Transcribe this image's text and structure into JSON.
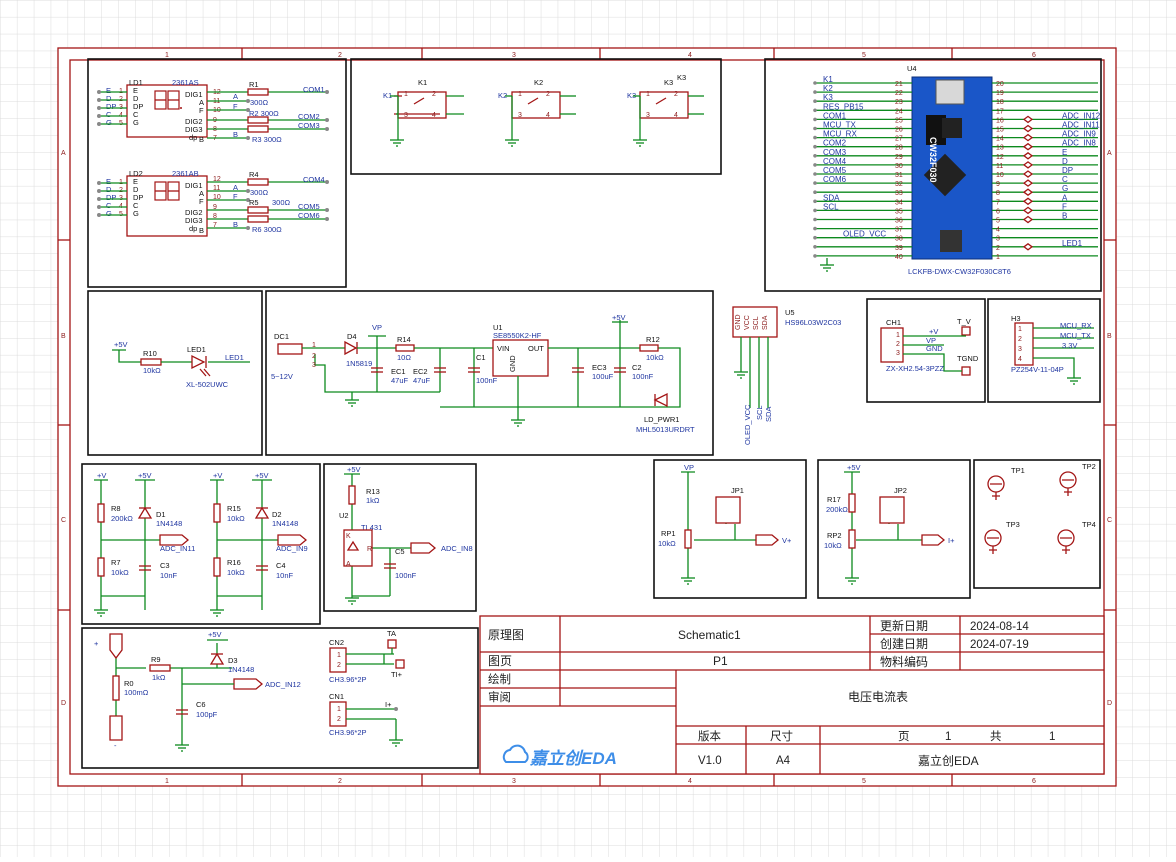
{
  "title_block": {
    "schematic_label": "原理图",
    "schematic_name": "Schematic1",
    "page_label": "图页",
    "page_value": "P1",
    "drawn_label": "绘制",
    "review_label": "审阅",
    "update_date_label": "更新日期",
    "update_date": "2024-08-14",
    "create_date_label": "创建日期",
    "create_date": "2024-07-19",
    "part_no_label": "物料编码",
    "project_name": "电压电流表",
    "version_label": "版本",
    "version": "V1.0",
    "size_label": "尺寸",
    "size": "A4",
    "page_no_label": "页",
    "page_no": "1",
    "total_label": "共",
    "total": "1",
    "company": "嘉立创EDA",
    "logo_text": "嘉立创EDA"
  },
  "frame": {
    "cols": [
      "1",
      "2",
      "3",
      "4",
      "5",
      "6"
    ],
    "rows": [
      "A",
      "B",
      "C",
      "D"
    ]
  },
  "display": {
    "d1": {
      "ref": "LD1",
      "part": "2361AS",
      "left_pins": [
        "E",
        "D",
        "DP",
        "C",
        "G"
      ],
      "left_nums": [
        "1",
        "2",
        "3",
        "4",
        "5"
      ],
      "inner_left": [
        "E",
        "D",
        "DP",
        "C",
        "G"
      ],
      "inner_right": [
        "DIG1",
        "A",
        "F",
        "DIG2",
        "DIG3",
        "B"
      ],
      "inner_right2": [
        "dp"
      ],
      "right_nums": [
        "12",
        "11",
        "10",
        "9",
        "8",
        "7"
      ]
    },
    "d2": {
      "ref": "LD2",
      "part": "2361AB",
      "left_pins": [
        "E",
        "D",
        "DP",
        "C",
        "G"
      ],
      "left_nums": [
        "1",
        "2",
        "3",
        "4",
        "5"
      ],
      "inner_left": [
        "E",
        "D",
        "DP",
        "C",
        "G"
      ],
      "inner_right": [
        "DIG1",
        "A",
        "F",
        "DIG2",
        "DIG3",
        "B"
      ],
      "inner_right2": [
        "dp"
      ],
      "right_nums": [
        "12",
        "11",
        "10",
        "9",
        "8",
        "7"
      ]
    },
    "r1": "R1",
    "r1v": "300Ω",
    "r2": "R2 300Ω",
    "r3": "R3 300Ω",
    "com1": "COM1",
    "com2": "COM2",
    "com3": "COM3",
    "A1": "A",
    "F1": "F",
    "B1": "B",
    "r4": "R4",
    "r4v": "300Ω",
    "r5": "R5",
    "r5v": "300Ω",
    "r6": "R6 300Ω",
    "com4": "COM4",
    "com5": "COM5",
    "com6": "COM6"
  },
  "keys": [
    {
      "ref": "K1",
      "net": "K1",
      "sub": "K1"
    },
    {
      "ref": "K2",
      "net": "K2",
      "sub": "K2"
    },
    {
      "ref": "K3",
      "net": "K3",
      "sub": "K3"
    }
  ],
  "mcu": {
    "ref": "U4",
    "part": "LCKFB-DWX-CW32F030C8T6",
    "left_nets": [
      "K1",
      "K2",
      "K3",
      "RES_PB15",
      "COM1",
      "MCU_TX",
      "MCU_RX",
      "COM2",
      "COM3",
      "COM4",
      "COM5",
      "COM6",
      "",
      "SDA",
      "SCL",
      "",
      "",
      "OLED_VCC"
    ],
    "left_nums": [
      "21",
      "22",
      "23",
      "24",
      "25",
      "26",
      "27",
      "28",
      "29",
      "30",
      "31",
      "32",
      "33",
      "34",
      "35",
      "36",
      "37",
      "38",
      "39",
      "40"
    ],
    "right_nums": [
      "20",
      "19",
      "18",
      "17",
      "16",
      "15",
      "14",
      "13",
      "12",
      "11",
      "10",
      "9",
      "8",
      "7",
      "6",
      "5",
      "4",
      "3",
      "2",
      "1"
    ],
    "right_nets": [
      "",
      "",
      "",
      "",
      "ADC_IN12",
      "ADC_IN11",
      "ADC_IN9",
      "ADC_IN8",
      "E",
      "D",
      "DP",
      "C",
      "G",
      "A",
      "F",
      "B",
      "",
      "",
      "LED1",
      ""
    ],
    "chip_text": "CW32F030"
  },
  "led_block": {
    "vcc": "+5V",
    "r": "R10",
    "rv": "10kΩ",
    "led": "LED1",
    "part": "XL-502UWC",
    "net": "LED1"
  },
  "power": {
    "dc": "DC1",
    "dc_part": "5~12V",
    "d": "D4",
    "d_part": "1N5819",
    "vp": "VP",
    "r": "R14",
    "rv": "10Ω",
    "ec1": "EC1",
    "ec1v": "47uF",
    "ec2": "EC2",
    "ec2v": "47uF",
    "c1": "C1",
    "c1v": "100nF",
    "u": "U1",
    "u_part": "SE8550K2-HF",
    "vin": "VIN",
    "out": "OUT",
    "gnd": "GND",
    "ec3": "EC3",
    "ec3v": "100uF",
    "c2": "C2",
    "c2v": "100nF",
    "p5v": "+5V",
    "r12": "R12",
    "r12v": "10kΩ",
    "led": "LD_PWR1",
    "led_part": "MHL5013URDRT"
  },
  "oled": {
    "ref": "U5",
    "part": "HS96L03W2C03",
    "pins": [
      "GND",
      "VCC",
      "SCL",
      "SDA"
    ],
    "nets": [
      "OLED_VCC",
      "SCL",
      "SDA"
    ]
  },
  "ch1": {
    "ref": "CH1",
    "part": "ZX-XH2.54-3PZZ",
    "pins": [
      "+V",
      "VP",
      "GND"
    ],
    "t1": "T_V",
    "t2": "TGND"
  },
  "h3": {
    "ref": "H3",
    "part": "PZ254V-11-04P",
    "nets": [
      "MCU_RX",
      "MCU_TX",
      "3.3V"
    ]
  },
  "div1": {
    "vp": "+V",
    "v5": "+5V",
    "r8": "R8",
    "r8v": "200kΩ",
    "d1": "D1",
    "d1p": "1N4148",
    "r7": "R7",
    "r7v": "10kΩ",
    "c3": "C3",
    "c3v": "10nF",
    "net": "ADC_IN11"
  },
  "div2": {
    "vp": "+V",
    "v5": "+5V",
    "r15": "R15",
    "r15v": "10kΩ",
    "d2": "D2",
    "d2p": "1N4148",
    "r16": "R16",
    "r16v": "10kΩ",
    "c4": "C4",
    "c4v": "10nF",
    "net": "ADC_IN9"
  },
  "ref431": {
    "v5": "+5V",
    "r13": "R13",
    "r13v": "1kΩ",
    "u": "U2",
    "part": "TL431",
    "k": "K",
    "rr": "R",
    "a": "A",
    "c5": "C5",
    "c5v": "100nF",
    "net": "ADC_IN8"
  },
  "jp1": {
    "vp": "VP",
    "ref": "JP1",
    "rp": "RP1",
    "rpv": "10kΩ",
    "net": "V+"
  },
  "jp2": {
    "v5": "+5V",
    "ref": "JP2",
    "r17": "R17",
    "r17v": "200kΩ",
    "rp": "RP2",
    "rpv": "10kΩ",
    "net": "I+"
  },
  "tps": [
    "TP1",
    "TP2",
    "TP3",
    "TP4"
  ],
  "shunt": {
    "top": "+",
    "bot": "-",
    "r0": "R0",
    "r0v": "100mΩ",
    "r9": "R9",
    "r9v": "1kΩ",
    "v5": "+5V",
    "d3": "D3",
    "d3p": "1N4148",
    "c6": "C6",
    "c6v": "100pF",
    "net": "ADC_IN12",
    "cn2": "CN2",
    "cn2p": "CH3.96*2P",
    "ta": "TA",
    "tip": "TI+",
    "cn1": "CN1",
    "cn1p": "CH3.96*2P",
    "ip": "I+"
  }
}
